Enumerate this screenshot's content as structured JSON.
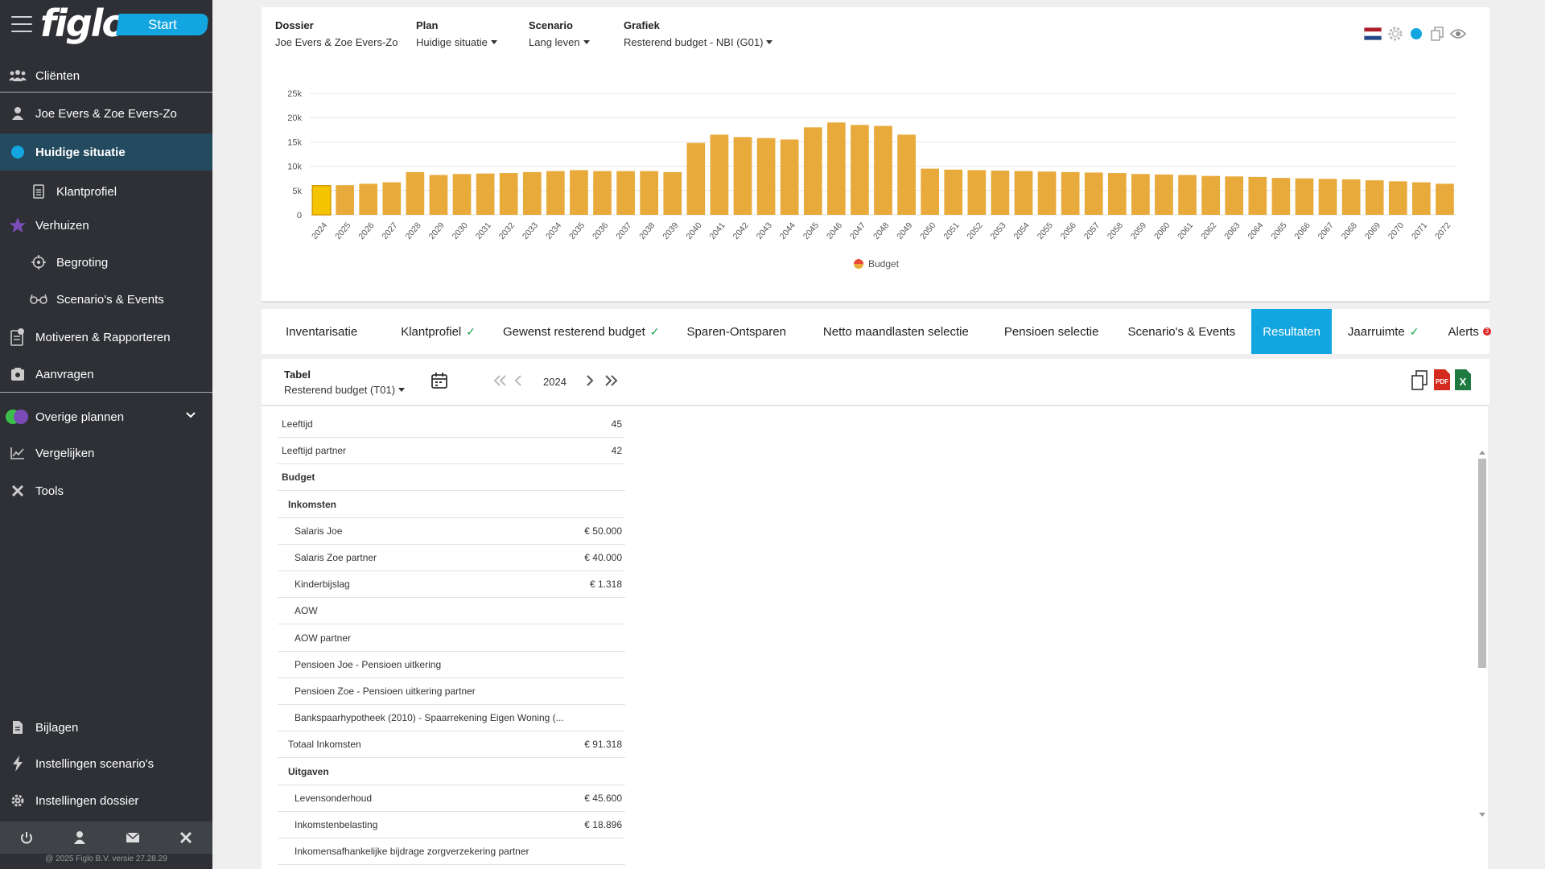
{
  "app": {
    "logo": "figlo",
    "start_label": "Start",
    "copyright": "@ 2025 Figlo B.V. versie 27.28.29"
  },
  "sidebar": {
    "items": [
      {
        "label": "Cliënten",
        "icon": "users-icon"
      },
      {
        "label": "Joe Evers & Zoe Evers-Zo",
        "icon": "user-icon"
      },
      {
        "label": "Huidige situatie",
        "icon": "circle-icon",
        "active": true
      },
      {
        "label": "Klantprofiel",
        "icon": "document-icon"
      },
      {
        "label": "Verhuizen",
        "icon": "star-icon"
      },
      {
        "label": "Begroting",
        "icon": "target-icon"
      },
      {
        "label": "Scenario's & Events",
        "icon": "glasses-icon"
      },
      {
        "label": "Motiveren & Rapporteren",
        "icon": "report-icon"
      },
      {
        "label": "Aanvragen",
        "icon": "request-icon"
      },
      {
        "label": "Overige plannen",
        "icon": "plans-icon"
      },
      {
        "label": "Vergelijken",
        "icon": "chart-line-icon"
      },
      {
        "label": "Tools",
        "icon": "tools-icon"
      },
      {
        "label": "Bijlagen",
        "icon": "attachment-icon"
      },
      {
        "label": "Instellingen scenario's",
        "icon": "bolt-icon"
      },
      {
        "label": "Instellingen dossier",
        "icon": "gear-icon"
      }
    ]
  },
  "topbar": {
    "dossier_label": "Dossier",
    "dossier_value": "Joe Evers & Zoe Evers-Zo",
    "plan_label": "Plan",
    "plan_value": "Huidige situatie",
    "scenario_label": "Scenario",
    "scenario_value": "Lang leven",
    "grafiek_label": "Grafiek",
    "grafiek_value": "Resterend budget - NBI (G01)"
  },
  "tabs": [
    {
      "label": "Inventarisatie"
    },
    {
      "label": "Klantprofiel",
      "check": true
    },
    {
      "label": "Gewenst resterend budget",
      "check": true
    },
    {
      "label": "Sparen-Ontsparen"
    },
    {
      "label": "Netto maandlasten selectie"
    },
    {
      "label": "Pensioen selectie"
    },
    {
      "label": "Scenario's & Events"
    },
    {
      "label": "Resultaten",
      "active": true
    },
    {
      "label": "Jaarruimte",
      "check": true
    },
    {
      "label": "Alerts",
      "badge": "3"
    }
  ],
  "check_mark": "✓",
  "table_header": {
    "label": "Tabel",
    "value": "Resterend budget (T01)",
    "year": "2024"
  },
  "rows": [
    {
      "label": "Leeftijd",
      "value": "45",
      "indent": 0,
      "bold": false
    },
    {
      "label": "Leeftijd partner",
      "value": "42",
      "indent": 0,
      "bold": false
    },
    {
      "label": "Budget",
      "value": "",
      "indent": 0,
      "bold": true
    },
    {
      "label": "Inkomsten",
      "value": "",
      "indent": 1,
      "bold": true
    },
    {
      "label": "Salaris Joe",
      "value": "€ 50.000",
      "indent": 2,
      "bold": false
    },
    {
      "label": "Salaris Zoe partner",
      "value": "€ 40.000",
      "indent": 2,
      "bold": false
    },
    {
      "label": "Kinderbijslag",
      "value": "€ 1.318",
      "indent": 2,
      "bold": false
    },
    {
      "label": "AOW",
      "value": "",
      "indent": 2,
      "bold": false
    },
    {
      "label": "AOW partner",
      "value": "",
      "indent": 2,
      "bold": false
    },
    {
      "label": "Pensioen Joe - Pensioen uitkering",
      "value": "",
      "indent": 2,
      "bold": false
    },
    {
      "label": "Pensioen Zoe - Pensioen uitkering partner",
      "value": "",
      "indent": 2,
      "bold": false
    },
    {
      "label": "Bankspaarhypotheek (2010) - Spaarrekening Eigen Woning (...",
      "value": "",
      "indent": 2,
      "bold": false
    },
    {
      "label": "Totaal Inkomsten",
      "value": "€ 91.318",
      "indent": 1,
      "bold": false
    },
    {
      "label": "Uitgaven",
      "value": "",
      "indent": 1,
      "bold": true
    },
    {
      "label": "Levensonderhoud",
      "value": "€ 45.600",
      "indent": 2,
      "bold": false
    },
    {
      "label": "Inkomstenbelasting",
      "value": "€ 18.896",
      "indent": 2,
      "bold": false
    },
    {
      "label": "Inkomensafhankelijke bijdrage zorgverzekering partner",
      "value": "",
      "indent": 2,
      "bold": false
    }
  ],
  "colors": {
    "bar": "#e8aa3a",
    "bar_highlight": "#f5c400",
    "accent": "#13a5e0",
    "sidebar_bg": "#2e3035",
    "sidebar_active": "#234a5e"
  },
  "chart_data": {
    "type": "bar",
    "categories": [
      "2024",
      "2025",
      "2026",
      "2027",
      "2028",
      "2029",
      "2030",
      "2031",
      "2032",
      "2033",
      "2034",
      "2035",
      "2036",
      "2037",
      "2038",
      "2039",
      "2040",
      "2041",
      "2042",
      "2043",
      "2044",
      "2045",
      "2046",
      "2047",
      "2048",
      "2049",
      "2050",
      "2051",
      "2052",
      "2053",
      "2054",
      "2055",
      "2056",
      "2057",
      "2058",
      "2059",
      "2060",
      "2061",
      "2062",
      "2063",
      "2064",
      "2065",
      "2066",
      "2067",
      "2068",
      "2069",
      "2070",
      "2071",
      "2072"
    ],
    "series": [
      {
        "name": "Budget",
        "values": [
          6000,
          6100,
          6400,
          6700,
          8800,
          8200,
          8400,
          8500,
          8600,
          8800,
          9000,
          9200,
          9000,
          9000,
          9000,
          8800,
          14800,
          16500,
          16000,
          15800,
          15500,
          18000,
          19000,
          18500,
          18300,
          16500,
          9500,
          9300,
          9200,
          9100,
          9000,
          8900,
          8800,
          8700,
          8600,
          8400,
          8300,
          8200,
          8000,
          7900,
          7800,
          7600,
          7500,
          7400,
          7300,
          7100,
          6900,
          6700,
          6400
        ]
      }
    ],
    "highlight_index": 0,
    "yticks": [
      "0",
      "5k",
      "10k",
      "15k",
      "20k",
      "25k"
    ],
    "ylim": [
      0,
      25000
    ],
    "legend_position": "bottom-center",
    "grid": true
  }
}
